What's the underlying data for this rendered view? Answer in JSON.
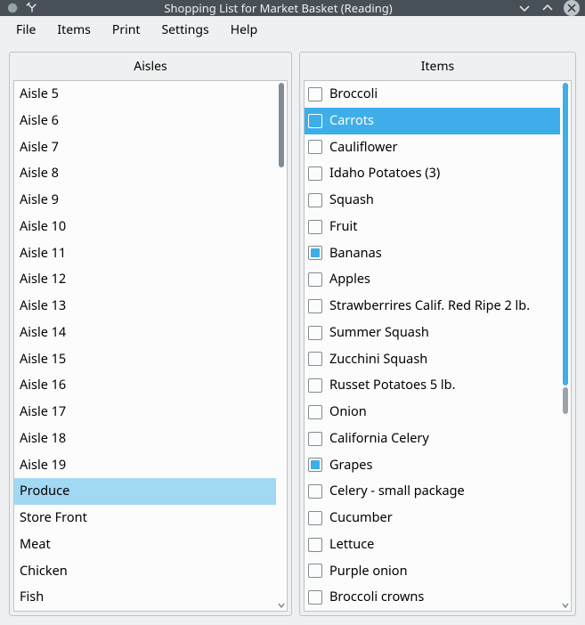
{
  "title": "Shopping List for Market Basket (Reading)",
  "menu": [
    "File",
    "Items",
    "Print",
    "Settings",
    "Help"
  ],
  "panels": {
    "aisles": "Aisles",
    "items": "Items"
  },
  "aisles": [
    {
      "label": "Aisle 5",
      "selected": false
    },
    {
      "label": "Aisle 6",
      "selected": false
    },
    {
      "label": "Aisle 7",
      "selected": false
    },
    {
      "label": "Aisle 8",
      "selected": false
    },
    {
      "label": "Aisle 9",
      "selected": false
    },
    {
      "label": "Aisle 10",
      "selected": false
    },
    {
      "label": "Aisle 11",
      "selected": false
    },
    {
      "label": "Aisle 12",
      "selected": false
    },
    {
      "label": "Aisle 13",
      "selected": false
    },
    {
      "label": "Aisle 14",
      "selected": false
    },
    {
      "label": "Aisle 15",
      "selected": false
    },
    {
      "label": "Aisle 16",
      "selected": false
    },
    {
      "label": "Aisle 17",
      "selected": false
    },
    {
      "label": "Aisle 18",
      "selected": false
    },
    {
      "label": "Aisle 19",
      "selected": false
    },
    {
      "label": "Produce",
      "selected": true
    },
    {
      "label": "Store Front",
      "selected": false
    },
    {
      "label": "Meat",
      "selected": false
    },
    {
      "label": "Chicken",
      "selected": false
    },
    {
      "label": "Fish",
      "selected": false
    }
  ],
  "items": [
    {
      "label": "Broccoli",
      "checked": false,
      "selected": false
    },
    {
      "label": "Carrots",
      "checked": false,
      "selected": true
    },
    {
      "label": "Cauliflower",
      "checked": false,
      "selected": false
    },
    {
      "label": "Idaho Potatoes (3)",
      "checked": false,
      "selected": false
    },
    {
      "label": "Squash",
      "checked": false,
      "selected": false
    },
    {
      "label": "Fruit",
      "checked": false,
      "selected": false
    },
    {
      "label": "Bananas",
      "checked": true,
      "selected": false
    },
    {
      "label": "Apples",
      "checked": false,
      "selected": false
    },
    {
      "label": "Strawberrires Calif. Red Ripe 2 lb.",
      "checked": false,
      "selected": false
    },
    {
      "label": "Summer Squash",
      "checked": false,
      "selected": false
    },
    {
      "label": "Zucchini Squash",
      "checked": false,
      "selected": false
    },
    {
      "label": "Russet Potatoes 5 lb.",
      "checked": false,
      "selected": false
    },
    {
      "label": "Onion",
      "checked": false,
      "selected": false
    },
    {
      "label": "California Celery",
      "checked": false,
      "selected": false
    },
    {
      "label": "Grapes",
      "checked": true,
      "selected": false
    },
    {
      "label": "Celery - small package",
      "checked": false,
      "selected": false
    },
    {
      "label": "Cucumber",
      "checked": false,
      "selected": false
    },
    {
      "label": "Lettuce",
      "checked": false,
      "selected": false
    },
    {
      "label": "Purple onion",
      "checked": false,
      "selected": false
    },
    {
      "label": "Broccoli crowns",
      "checked": false,
      "selected": false
    }
  ]
}
